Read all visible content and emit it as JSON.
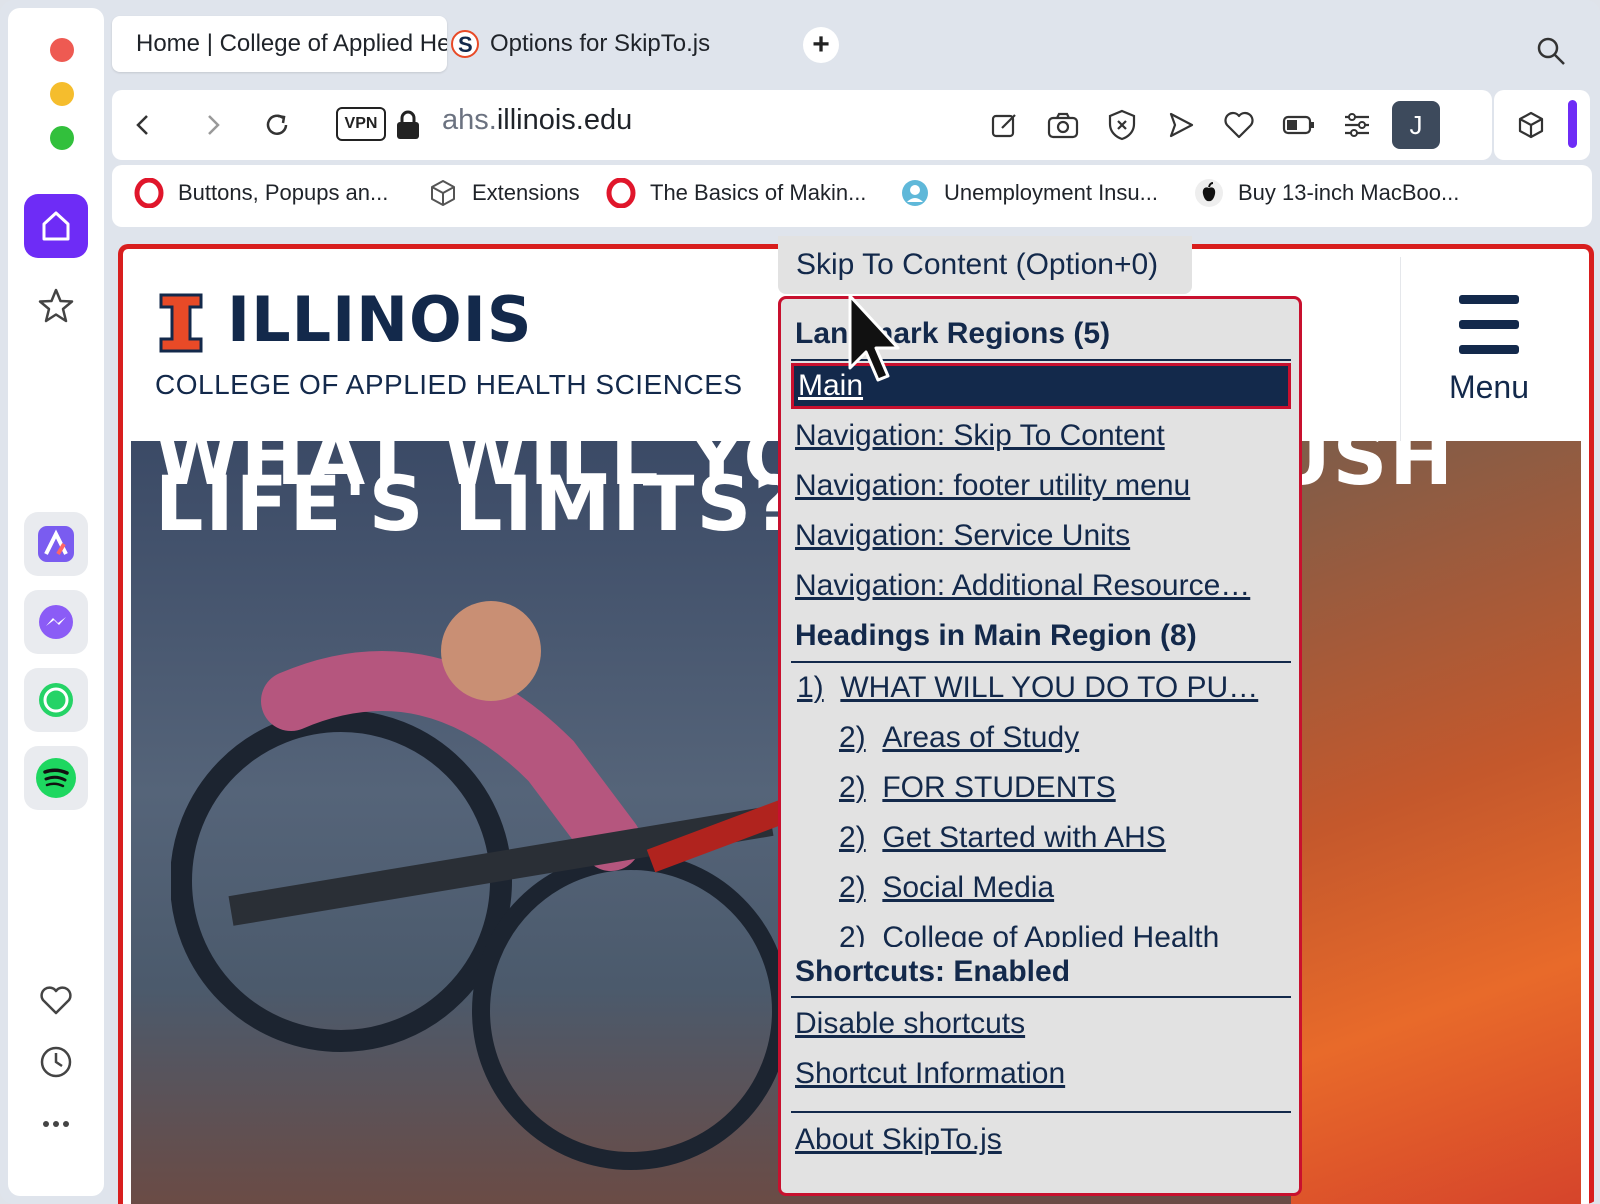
{
  "tabs": [
    {
      "title": "Home | College of Applied Health Sciences",
      "active": true
    },
    {
      "title": "Options for SkipTo.js",
      "active": false
    }
  ],
  "address_bar": {
    "vpn_label": "VPN",
    "url_domain_prefix": "ahs.",
    "url_domain_main": "illinois.edu"
  },
  "profile": {
    "initial": "J"
  },
  "bookmarks": [
    {
      "label": "Buttons, Popups an...",
      "icon": "opera-icon"
    },
    {
      "label": "Extensions",
      "icon": "cube-icon"
    },
    {
      "label": "The Basics of Makin...",
      "icon": "opera-icon"
    },
    {
      "label": "Unemployment Insu...",
      "icon": "person-icon"
    },
    {
      "label": "Buy 13-inch MacBoo...",
      "icon": "apple-icon"
    }
  ],
  "page": {
    "logo_word": "ILLINOIS",
    "logo_sub": "COLLEGE OF APPLIED HEALTH SCIENCES",
    "menu_label": "Menu",
    "hero_line1": "WHAT WILL YOU DO TO PUSH",
    "hero_line2": "LIFE'S LIMITS?"
  },
  "skipto": {
    "button_label": "Skip To Content (Option+0)",
    "landmarks_heading": "Landmark Regions (5)",
    "landmarks": [
      "Main",
      "Navigation: Skip To Content",
      "Navigation: footer utility menu",
      "Navigation: Service Units",
      "Navigation: Additional Resource…"
    ],
    "headings_heading": "Headings in Main Region (8)",
    "headings": [
      {
        "level": "1)",
        "text": "WHAT WILL YOU DO TO PU…"
      },
      {
        "level": "2)",
        "text": "Areas of Study"
      },
      {
        "level": "2)",
        "text": "FOR STUDENTS"
      },
      {
        "level": "2)",
        "text": "Get Started with AHS"
      },
      {
        "level": "2)",
        "text": "Social Media"
      },
      {
        "level": "2)",
        "text": "College of Applied Health"
      }
    ],
    "shortcuts_heading": "Shortcuts: Enabled",
    "shortcut_items": [
      "Disable shortcuts",
      "Shortcut Information"
    ],
    "about": "About SkipTo.js"
  },
  "colors": {
    "illinois_blue": "#13294b",
    "illinois_orange": "#e84a27",
    "focus_red": "#c8102e",
    "opera_purple": "#6e2cf6"
  }
}
